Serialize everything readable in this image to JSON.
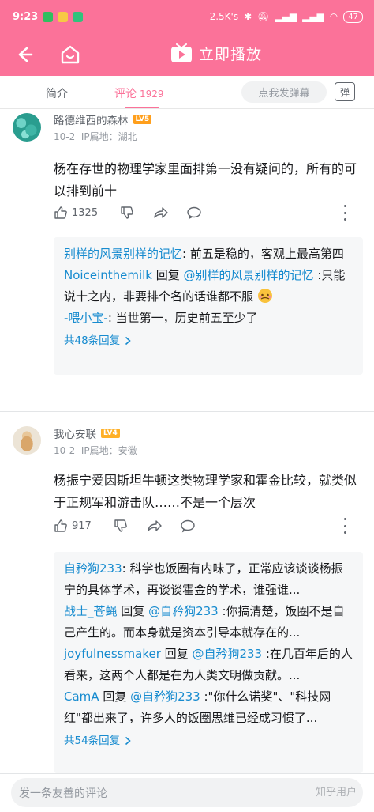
{
  "status_bar": {
    "time": "9:23",
    "speed": "2.5K's",
    "battery": "47"
  },
  "app_bar": {
    "play_label": "立即播放"
  },
  "tabs": {
    "intro": "简介",
    "comments": "评论",
    "comments_count": "1929",
    "danmaku_placeholder": "点我发弹幕",
    "danmaku_button": "弹"
  },
  "comments": [
    {
      "username": "路德维西的森林",
      "level": "LV5",
      "date": "10-2",
      "ip": "IP属地：湖北",
      "text": "杨在存世的物理学家里面排第一没有疑问的，所有的可以排到前十",
      "likes": "1325",
      "replies": [
        {
          "author": "别样的风景别样的记忆",
          "text": ": 前五是稳的，客观上最高第四"
        },
        {
          "author": "Noiceinthemilk",
          "reply_word": " 回复 ",
          "mention": "@别样的风景别样的记忆",
          "text": " :只能说十之内，非要排个名的话谁都不服"
        },
        {
          "author": "-喂小宝-",
          "text": ": 当世第一，历史前五至少了"
        }
      ],
      "reply_more": "共48条回复"
    },
    {
      "username": "我心安联",
      "level": "LV4",
      "date": "10-2",
      "ip": "IP属地：安徽",
      "text": "杨振宁爱因斯坦牛顿这类物理学家和霍金比较，就类似于正规军和游击队……不是一个层次",
      "likes": "917",
      "replies": [
        {
          "author": "自矜狗233",
          "text": ": 科学也饭圈有内味了，正常应该谈谈杨振宁的具体学术，再谈谈霍金的学术，谁强谁..."
        },
        {
          "author": "战士_苍蝇",
          "reply_word": " 回复 ",
          "mention": "@自矜狗233",
          "text": " :你搞清楚，饭圈不是自己产生的。而本身就是资本引导本就存在的..."
        },
        {
          "author": "joyfulnessmaker",
          "reply_word": " 回复 ",
          "mention": "@自矜狗233",
          "text": " :在几百年后的人看来，这两个人都是在为人类文明做贡献。..."
        },
        {
          "author": "CamA",
          "reply_word": " 回复 ",
          "mention": "@自矜狗233",
          "text": " :\"你什么诺奖\"、\"科技网红\"都出来了，许多人的饭圈思维已经成习惯了..."
        }
      ],
      "reply_more": "共54条回复"
    }
  ],
  "bottom": {
    "placeholder": "发一条友善的评论",
    "watermark": "知乎用户"
  },
  "colors": {
    "brand": "#fb7299",
    "link": "#178bcf"
  }
}
